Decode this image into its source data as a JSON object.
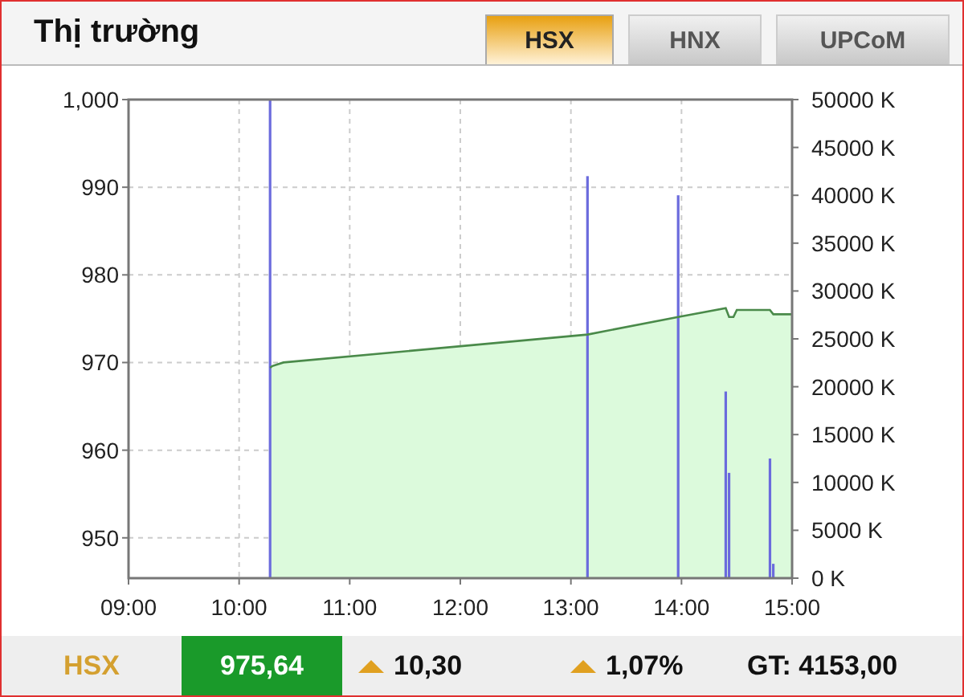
{
  "header": {
    "title": "Thị trường"
  },
  "tabs": [
    {
      "label": "HSX",
      "selected": true
    },
    {
      "label": "HNX",
      "selected": false
    },
    {
      "label": "UPCoM",
      "selected": false
    }
  ],
  "chart_data": {
    "type": "area",
    "x": [
      10.28,
      10.3,
      10.4,
      13.15,
      13.97,
      14.4,
      14.43,
      14.47,
      14.5,
      14.8,
      14.83,
      15.0
    ],
    "grid": true,
    "xlim": [
      9,
      15
    ],
    "ylim": [
      945.4,
      1000
    ],
    "xticks": [
      {
        "value": 9,
        "label": "09:00"
      },
      {
        "value": 10,
        "label": "10:00"
      },
      {
        "value": 11,
        "label": "11:00"
      },
      {
        "value": 12,
        "label": "12:00"
      },
      {
        "value": 13,
        "label": "13:00"
      },
      {
        "value": 14,
        "label": "14:00"
      },
      {
        "value": 15,
        "label": "15:00"
      }
    ],
    "yticks": [
      {
        "value": 1000,
        "label": "1,000"
      },
      950,
      960,
      970,
      980,
      990
    ],
    "y2lim": [
      0,
      50000
    ],
    "y2ticks": [
      {
        "value": 0,
        "label": "0 K"
      },
      {
        "value": 5000,
        "label": "5000 K"
      },
      {
        "value": 10000,
        "label": "10000 K"
      },
      {
        "value": 15000,
        "label": "15000 K"
      },
      {
        "value": 20000,
        "label": "20000 K"
      },
      {
        "value": 25000,
        "label": "25000 K"
      },
      {
        "value": 30000,
        "label": "30000 K"
      },
      {
        "value": 35000,
        "label": "35000 K"
      },
      {
        "value": 40000,
        "label": "40000 K"
      },
      {
        "value": 45000,
        "label": "45000 K"
      },
      {
        "value": 50000,
        "label": "50000 K"
      }
    ],
    "series": [
      {
        "color": "#4a8a4a",
        "values": [
          969.4,
          969.6,
          970.0,
          973.2,
          975.2,
          976.2,
          975.2,
          975.2,
          976.0,
          976.0,
          975.5,
          975.5
        ]
      },
      {
        "color": "#6b6bdd",
        "axis": "y2",
        "values": [
          50000,
          null,
          null,
          42000,
          40000,
          19500,
          11000,
          null,
          null,
          12500,
          1500,
          null
        ]
      }
    ]
  },
  "summary": {
    "index": "HSX",
    "value": "975,64",
    "change": {
      "value": "10,30",
      "kind": "up"
    },
    "percent": {
      "value": "1,07%",
      "kind": "up"
    },
    "turnover": "GT: 4153,00"
  }
}
